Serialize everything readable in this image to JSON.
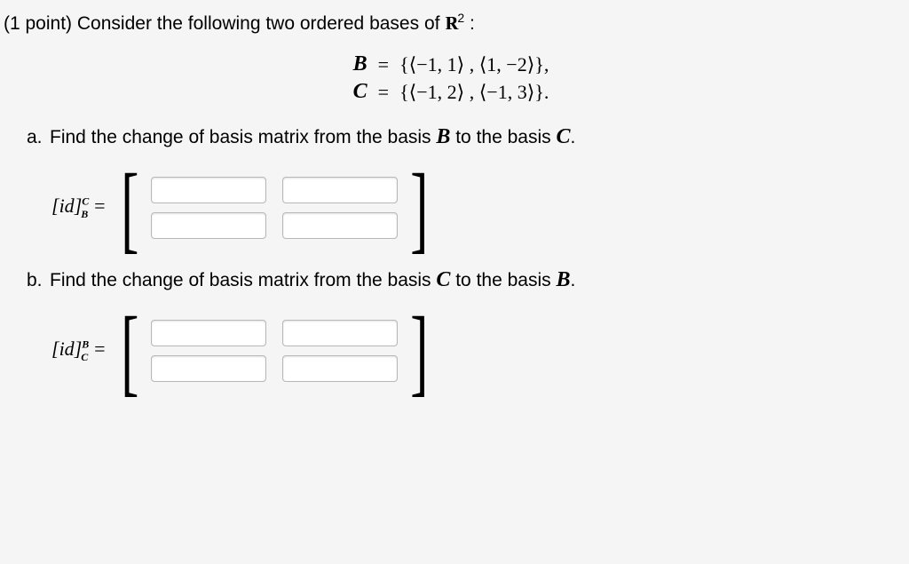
{
  "points_label": "(1 point)",
  "intro_text": "Consider the following two ordered bases of ",
  "space_symbol": "ℝ",
  "space_exponent": "2",
  "colon": " :",
  "bases": {
    "B_symbol": "B",
    "C_symbol": "C",
    "equals": "=",
    "B_set": "{⟨−1, 1⟩ , ⟨1, −2⟩},",
    "C_set": "{⟨−1, 2⟩ , ⟨−1, 3⟩}."
  },
  "part_a": {
    "letter": "a.",
    "text_before": "Find the change of basis matrix from the basis ",
    "mid": " to the basis ",
    "end": ".",
    "id_open": "[",
    "id_text": "id",
    "id_close": "]",
    "sup": "C",
    "sub": "B",
    "equals": " ="
  },
  "part_b": {
    "letter": "b.",
    "text_before": "Find the change of basis matrix from the basis ",
    "mid": " to the basis ",
    "end": ".",
    "id_open": "[",
    "id_text": "id",
    "id_close": "]",
    "sup": "B",
    "sub": "C",
    "equals": " ="
  },
  "matrix_a": {
    "r1c1": "",
    "r1c2": "",
    "r2c1": "",
    "r2c2": ""
  },
  "matrix_b": {
    "r1c1": "",
    "r1c2": "",
    "r2c1": "",
    "r2c2": ""
  }
}
